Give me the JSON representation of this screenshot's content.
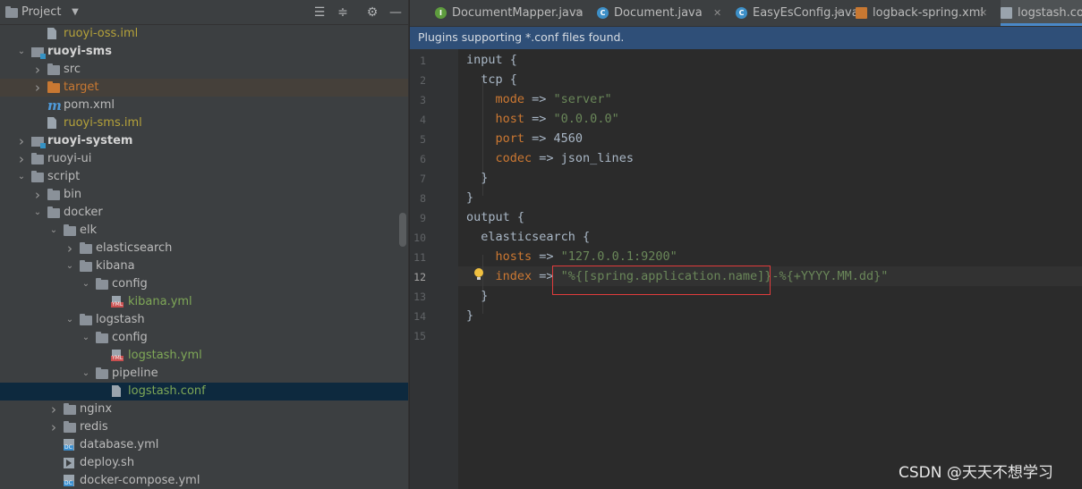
{
  "project_panel": {
    "title": "Project",
    "tree": [
      {
        "label": "ruoyi-oss.iml",
        "depth": 2,
        "kind": "iml",
        "color": "olive"
      },
      {
        "label": "ruoyi-sms",
        "depth": 1,
        "kind": "module",
        "expanded": true,
        "bold": true
      },
      {
        "label": "src",
        "depth": 2,
        "kind": "folder",
        "expanded": false
      },
      {
        "label": "target",
        "depth": 2,
        "kind": "folder-orange",
        "expanded": false,
        "color": "orange"
      },
      {
        "label": "pom.xml",
        "depth": 2,
        "kind": "maven"
      },
      {
        "label": "ruoyi-sms.iml",
        "depth": 2,
        "kind": "iml",
        "color": "olive"
      },
      {
        "label": "ruoyi-system",
        "depth": 1,
        "kind": "module",
        "expanded": false,
        "bold": true
      },
      {
        "label": "ruoyi-ui",
        "depth": 1,
        "kind": "folder",
        "expanded": false
      },
      {
        "label": "script",
        "depth": 1,
        "kind": "folder",
        "expanded": true
      },
      {
        "label": "bin",
        "depth": 2,
        "kind": "folder",
        "expanded": false
      },
      {
        "label": "docker",
        "depth": 2,
        "kind": "folder",
        "expanded": true
      },
      {
        "label": "elk",
        "depth": 3,
        "kind": "folder",
        "expanded": true
      },
      {
        "label": "elasticsearch",
        "depth": 4,
        "kind": "folder",
        "expanded": false
      },
      {
        "label": "kibana",
        "depth": 4,
        "kind": "folder",
        "expanded": true
      },
      {
        "label": "config",
        "depth": 5,
        "kind": "folder",
        "expanded": true
      },
      {
        "label": "kibana.yml",
        "depth": 6,
        "kind": "yml",
        "color": "green"
      },
      {
        "label": "logstash",
        "depth": 4,
        "kind": "folder",
        "expanded": true
      },
      {
        "label": "config",
        "depth": 5,
        "kind": "folder",
        "expanded": true
      },
      {
        "label": "logstash.yml",
        "depth": 6,
        "kind": "yml",
        "color": "green"
      },
      {
        "label": "pipeline",
        "depth": 5,
        "kind": "folder",
        "expanded": true
      },
      {
        "label": "logstash.conf",
        "depth": 6,
        "kind": "file",
        "color": "green",
        "selected": true
      },
      {
        "label": "nginx",
        "depth": 3,
        "kind": "folder",
        "expanded": false
      },
      {
        "label": "redis",
        "depth": 3,
        "kind": "folder",
        "expanded": false
      },
      {
        "label": "database.yml",
        "depth": 3,
        "kind": "dc"
      },
      {
        "label": "deploy.sh",
        "depth": 3,
        "kind": "sh"
      },
      {
        "label": "docker-compose.yml",
        "depth": 3,
        "kind": "dc"
      }
    ]
  },
  "tabs": [
    {
      "label": "DocumentMapper.java",
      "icon": "interface-icon",
      "icon_letter": "I",
      "icon_color": "#5e9c3e"
    },
    {
      "label": "Document.java",
      "icon": "class-icon",
      "icon_letter": "C",
      "icon_color": "#3d8fc7"
    },
    {
      "label": "EasyEsConfig.java",
      "icon": "class-icon",
      "icon_letter": "C",
      "icon_color": "#3d8fc7"
    },
    {
      "label": "logback-spring.xml",
      "icon": "xml-file-icon",
      "icon_letter": "",
      "icon_color": "#c87832"
    },
    {
      "label": "logstash.con",
      "icon": "text-file-icon",
      "icon_letter": "",
      "icon_color": "#9aa4ad",
      "active": true
    }
  ],
  "banner": {
    "text": "Plugins supporting *.conf files found."
  },
  "editor": {
    "current_line": 12,
    "lines": [
      [
        {
          "t": "input {",
          "c": "p"
        }
      ],
      [
        {
          "t": "  tcp {",
          "c": "p"
        }
      ],
      [
        {
          "t": "    mode",
          "c": "k"
        },
        {
          "t": " => ",
          "c": "p"
        },
        {
          "t": "\"server\"",
          "c": "s"
        }
      ],
      [
        {
          "t": "    host",
          "c": "k"
        },
        {
          "t": " => ",
          "c": "p"
        },
        {
          "t": "\"0.0.0.0\"",
          "c": "s"
        }
      ],
      [
        {
          "t": "    port",
          "c": "k"
        },
        {
          "t": " => 4560",
          "c": "p"
        }
      ],
      [
        {
          "t": "    codec",
          "c": "k"
        },
        {
          "t": " => json_lines",
          "c": "p"
        }
      ],
      [
        {
          "t": "  }",
          "c": "p"
        }
      ],
      [
        {
          "t": "}",
          "c": "p"
        }
      ],
      [
        {
          "t": "output {",
          "c": "p"
        }
      ],
      [
        {
          "t": "  elasticsearch {",
          "c": "p"
        }
      ],
      [
        {
          "t": "    hosts",
          "c": "k"
        },
        {
          "t": " => ",
          "c": "p"
        },
        {
          "t": "\"127.0.0.1:9200\"",
          "c": "s"
        }
      ],
      [
        {
          "t": "    index",
          "c": "k"
        },
        {
          "t": " => ",
          "c": "p"
        },
        {
          "t": "\"%{[spring.application.name]}-%{+YYYY.MM.dd}\"",
          "c": "s"
        }
      ],
      [
        {
          "t": "  }",
          "c": "p"
        }
      ],
      [
        {
          "t": "}",
          "c": "p"
        }
      ],
      []
    ]
  },
  "watermark": "CSDN @天天不想学习"
}
